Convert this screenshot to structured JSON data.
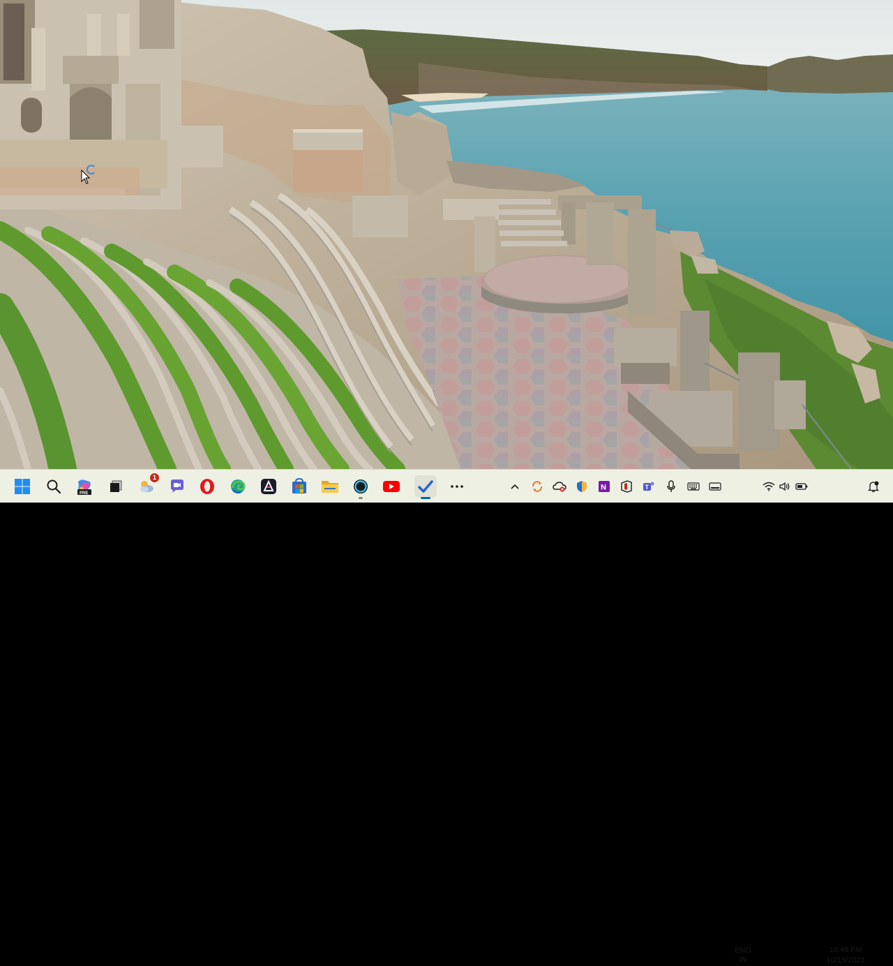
{
  "wallpaper": {
    "subject": "cliff-top open-air theatre overlooking the sea",
    "colors": {
      "sky": "#e6ebea",
      "sea": "#5aa6b3",
      "rock": "#b9a88f",
      "grass": "#5f9a2e",
      "stage": "#b7a39b"
    }
  },
  "taskbar": {
    "apps": [
      {
        "name": "start-button",
        "icon": "windows-logo-icon"
      },
      {
        "name": "search-button",
        "icon": "search-icon"
      },
      {
        "name": "copilot-button",
        "icon": "copilot-pre-icon",
        "label": "PRE"
      },
      {
        "name": "task-view-button",
        "icon": "task-view-icon"
      },
      {
        "name": "widgets-button",
        "icon": "weather-icon",
        "badge": "1"
      },
      {
        "name": "teams-chat-button",
        "icon": "chat-icon"
      },
      {
        "name": "opera-button",
        "icon": "opera-icon"
      },
      {
        "name": "edge-button",
        "icon": "edge-icon"
      },
      {
        "name": "affinity-button",
        "icon": "affinity-icon"
      },
      {
        "name": "store-button",
        "icon": "store-icon"
      },
      {
        "name": "file-explorer-button",
        "icon": "folder-icon"
      },
      {
        "name": "alexa-button",
        "icon": "alexa-icon"
      },
      {
        "name": "youtube-button",
        "icon": "youtube-icon"
      },
      {
        "name": "todo-button",
        "icon": "checkmark-icon",
        "active": true
      },
      {
        "name": "more-apps-button",
        "icon": "more-icon"
      }
    ],
    "tray": {
      "icons": [
        "chevron-up-icon",
        "sync-icon",
        "cloud-icon",
        "shield-icon",
        "onenote-icon",
        "office-icon",
        "teams-icon",
        "microphone-icon",
        "keyboard-icon",
        "display-icon"
      ],
      "language_line1": "ENG",
      "language_line2": "IN",
      "status_icons": [
        "wifi-icon",
        "volume-icon",
        "battery-icon"
      ],
      "time": "10:48 PM",
      "date": "10/13/2023",
      "notification_icon": "notification-bell-icon"
    },
    "accent": "#0067c0"
  }
}
